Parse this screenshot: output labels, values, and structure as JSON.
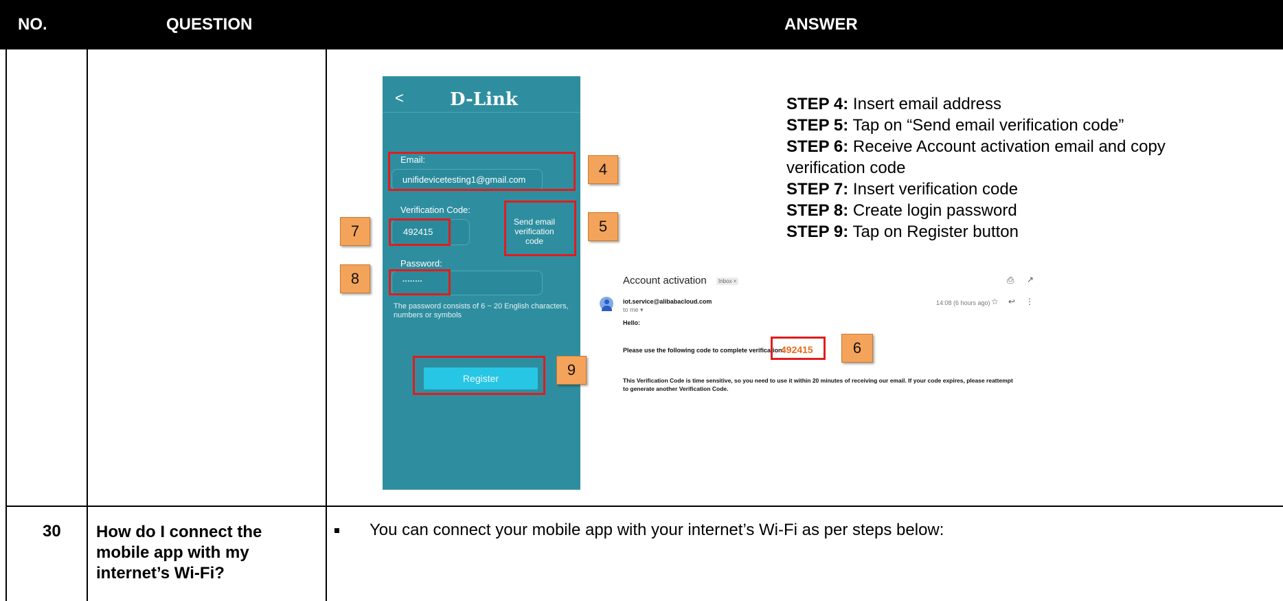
{
  "table": {
    "headers": {
      "no": "NO.",
      "question": "QUESTION",
      "answer": "ANSWER"
    }
  },
  "phone": {
    "back": "<",
    "logo": "D-Link",
    "email_label": "Email:",
    "email_value": "unifidevicetesting1@gmail.com",
    "code_label": "Verification Code:",
    "code_value": "492415",
    "send_code": "Send email verification code",
    "password_label": "Password:",
    "password_value": "········",
    "password_hint": "The password consists of 6 ~ 20 English characters, numbers or symbols",
    "register": "Register"
  },
  "badges": {
    "b4": "4",
    "b5": "5",
    "b6": "6",
    "b7": "7",
    "b8": "8",
    "b9": "9"
  },
  "steps": [
    {
      "label": "STEP 4:",
      "text": " Insert email address"
    },
    {
      "label": "STEP 5:",
      "text": " Tap on “Send email verification code”"
    },
    {
      "label": "STEP 6:",
      "text": " Receive Account activation email and copy"
    },
    {
      "label": "",
      "text": "verification code"
    },
    {
      "label": "STEP 7:",
      "text": " Insert verification code"
    },
    {
      "label": "STEP 8:",
      "text": " Create login password"
    },
    {
      "label": "STEP 9:",
      "text": " Tap on Register button"
    }
  ],
  "email": {
    "subject": "Account activation",
    "inbox_tag": "Inbox ×",
    "sender": "iot.service@alibabacloud.com",
    "to": "to me ▾",
    "time": "14:08 (6 hours ago)",
    "greeting": "Hello:",
    "line1": "Please use the following code to complete verification:",
    "code": "492415",
    "line2": "This Verification Code is time sensitive, so you need to use it within 20 minutes of receiving our email. If your code expires, please reattempt",
    "line3": "to generate another Verification Code."
  },
  "row30": {
    "number": "30",
    "question": "How do I connect the mobile app with my internet’s Wi-Fi?",
    "answer": "You can connect your mobile app with your internet’s Wi-Fi as per steps below:"
  }
}
